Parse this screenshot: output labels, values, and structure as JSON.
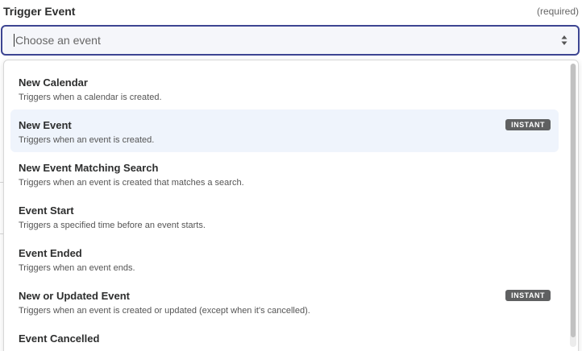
{
  "field": {
    "label": "Trigger Event",
    "required_text": "(required)",
    "placeholder": "Choose an event"
  },
  "options": [
    {
      "title": "New Calendar",
      "description": "Triggers when a calendar is created.",
      "badge": ""
    },
    {
      "title": "New Event",
      "description": "Triggers when an event is created.",
      "badge": "INSTANT",
      "highlighted": true
    },
    {
      "title": "New Event Matching Search",
      "description": "Triggers when an event is created that matches a search.",
      "badge": ""
    },
    {
      "title": "Event Start",
      "description": "Triggers a specified time before an event starts.",
      "badge": ""
    },
    {
      "title": "Event Ended",
      "description": "Triggers when an event ends.",
      "badge": ""
    },
    {
      "title": "New or Updated Event",
      "description": "Triggers when an event is created or updated (except when it's cancelled).",
      "badge": "INSTANT"
    },
    {
      "title": "Event Cancelled",
      "description": "",
      "badge": ""
    }
  ],
  "colors": {
    "focus_border": "#3d4592",
    "highlight_bg": "#eff4fc",
    "badge_bg": "#5f6061"
  },
  "icons": {
    "select": "chevron-up-down-icon"
  }
}
